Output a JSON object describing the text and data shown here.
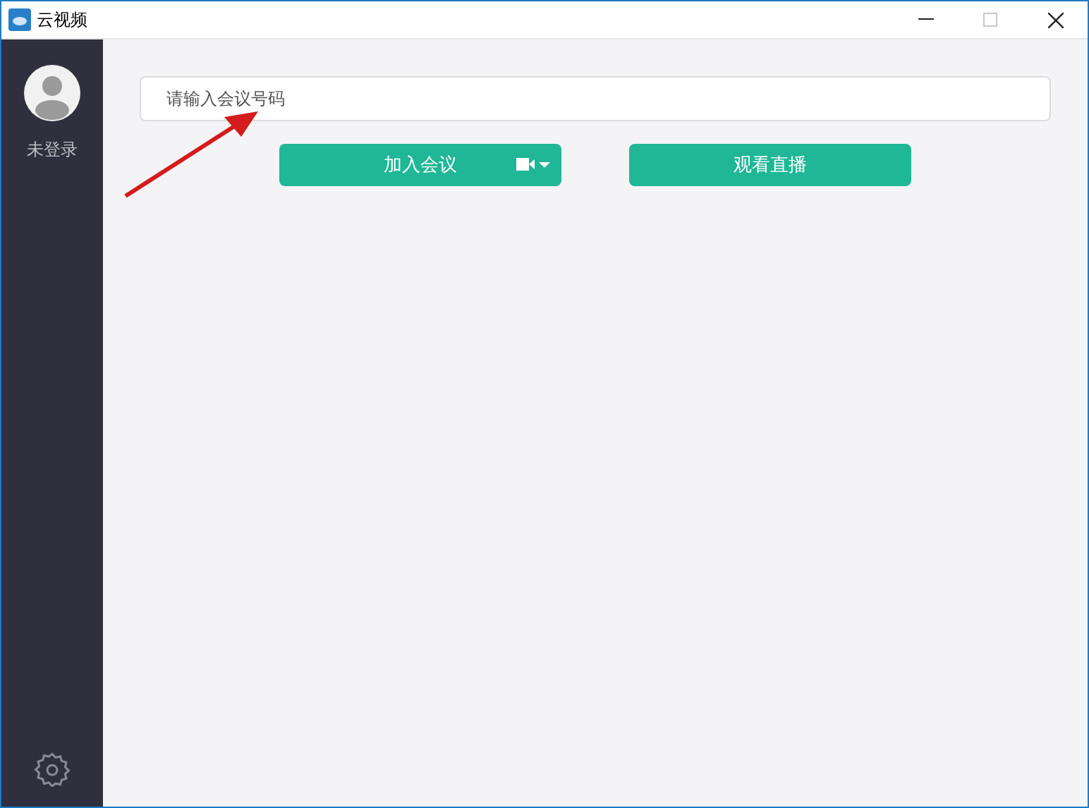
{
  "window": {
    "title": "云视频",
    "controls": [
      {
        "kind": "minimize",
        "disabled": false
      },
      {
        "kind": "maximize",
        "disabled": true
      },
      {
        "kind": "close",
        "disabled": false
      }
    ]
  },
  "sidebar": {
    "user_label": "未登录"
  },
  "meeting_field": {
    "placeholder": "请输入会议号码"
  },
  "buttons": [
    {
      "kind": "join",
      "label": "加入会议"
    },
    {
      "kind": "live",
      "label": "观看直播"
    }
  ],
  "annotation": {
    "kind": "arrow"
  }
}
